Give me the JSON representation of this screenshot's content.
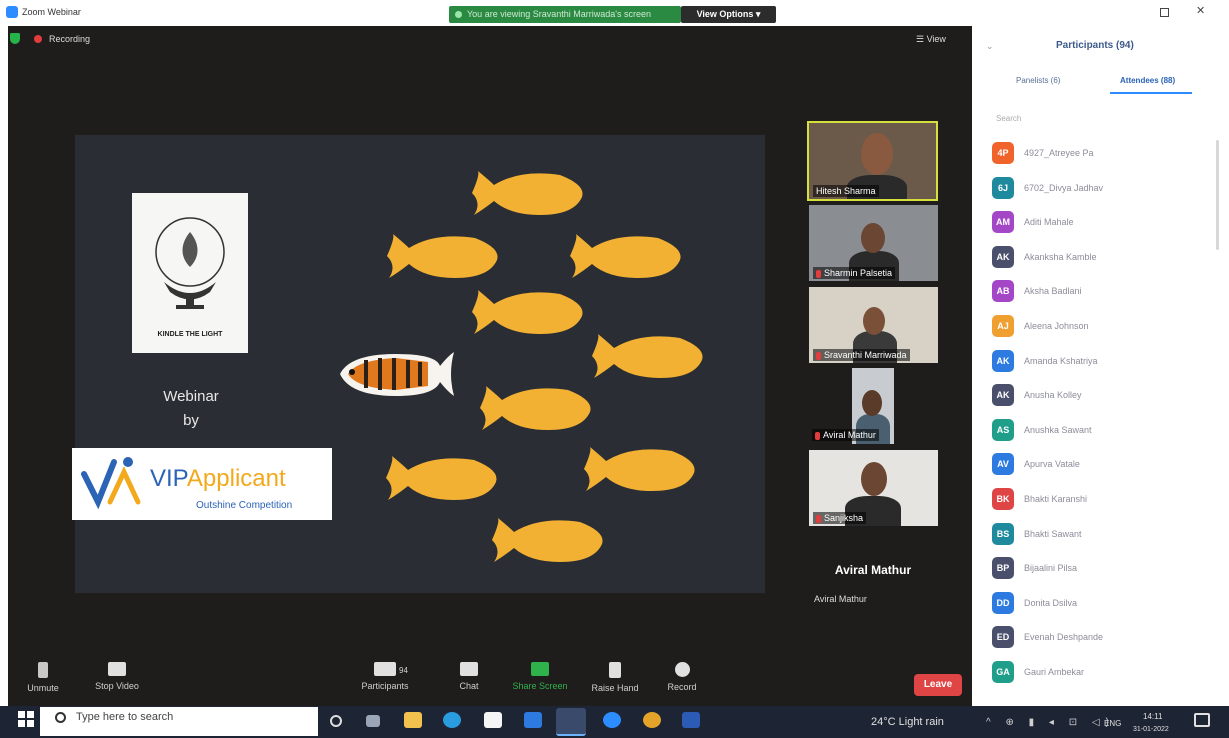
{
  "window": {
    "title": "Zoom Webinar",
    "share_banner": "You are viewing Sravanthi Marriwada's screen",
    "view_options": "View Options ▾"
  },
  "meeting": {
    "recording": "Recording",
    "view": "☰ View"
  },
  "slide": {
    "college_motto": "KINDLE THE LIGHT",
    "webinar_line1": "Webinar",
    "webinar_line2": "by",
    "brand_part1": "VIP",
    "brand_part2": "Applicant",
    "brand_tagline": "Outshine Competition"
  },
  "videos": [
    {
      "name": "Hitesh Sharma"
    },
    {
      "name": "Sharmin Palsetia"
    },
    {
      "name": "Sravanthi Marriwada"
    },
    {
      "name": "Aviral Mathur"
    },
    {
      "name": "Sanjiksha"
    }
  ],
  "active_speaker": {
    "name": "Aviral Mathur",
    "subtitle": "Aviral Mathur"
  },
  "toolbar": {
    "unmute": "Unmute",
    "stop_video": "Stop Video",
    "participants": "Participants",
    "participant_count": "94",
    "chat": "Chat",
    "share_screen": "Share Screen",
    "raise_hand": "Raise Hand",
    "record": "Record",
    "leave": "Leave"
  },
  "panel": {
    "title": "Participants (94)",
    "collapse": "⌄",
    "tab_panelists": "Panelists (6)",
    "tab_attendees": "Attendees (88)",
    "search_placeholder": "Search",
    "attendees": [
      {
        "initials": "4P",
        "name": "4927_Atreyee Pa",
        "color": "#f0632a"
      },
      {
        "initials": "6J",
        "name": "6702_Divya Jadhav",
        "color": "#1f8a9e"
      },
      {
        "initials": "AM",
        "name": "Aditi Mahale",
        "color": "#a347c7"
      },
      {
        "initials": "AK",
        "name": "Akanksha Kamble",
        "color": "#4a4f6b"
      },
      {
        "initials": "AB",
        "name": "Aksha Badlani",
        "color": "#a347c7"
      },
      {
        "initials": "AJ",
        "name": "Aleena Johnson",
        "color": "#f0a030"
      },
      {
        "initials": "AK",
        "name": "Amanda Kshatriya",
        "color": "#2d7be0"
      },
      {
        "initials": "AK",
        "name": "Anusha Kolley",
        "color": "#4a4f6b"
      },
      {
        "initials": "AS",
        "name": "Anushka Sawant",
        "color": "#1f9e8a"
      },
      {
        "initials": "AV",
        "name": "Apurva Vatale",
        "color": "#2d7be0"
      },
      {
        "initials": "BK",
        "name": "Bhakti Karanshi",
        "color": "#e04545"
      },
      {
        "initials": "BS",
        "name": "Bhakti Sawant",
        "color": "#1f8a9e"
      },
      {
        "initials": "BP",
        "name": "Bijaalini Pilsa",
        "color": "#4a4f6b"
      },
      {
        "initials": "DD",
        "name": "Donita Dsilva",
        "color": "#2d7be0"
      },
      {
        "initials": "ED",
        "name": "Evenah Deshpande",
        "color": "#4a4f6b"
      },
      {
        "initials": "GA",
        "name": "Gauri Ambekar",
        "color": "#1f9e8a"
      }
    ]
  },
  "taskbar": {
    "search_placeholder": "Type here to search",
    "weather": "24°C  Light rain",
    "tray": "^ ⊕ ▮ ◂ ⊡ ◁)",
    "lang": "ENG",
    "time": "14:11",
    "date": "31-01-2022"
  },
  "colors": {
    "meeting_bg": "#1f1c1c",
    "slide_bg": "#2a2d33",
    "fish": "#f2b132",
    "leave": "#e04545",
    "share_banner": "#2a8a42"
  }
}
